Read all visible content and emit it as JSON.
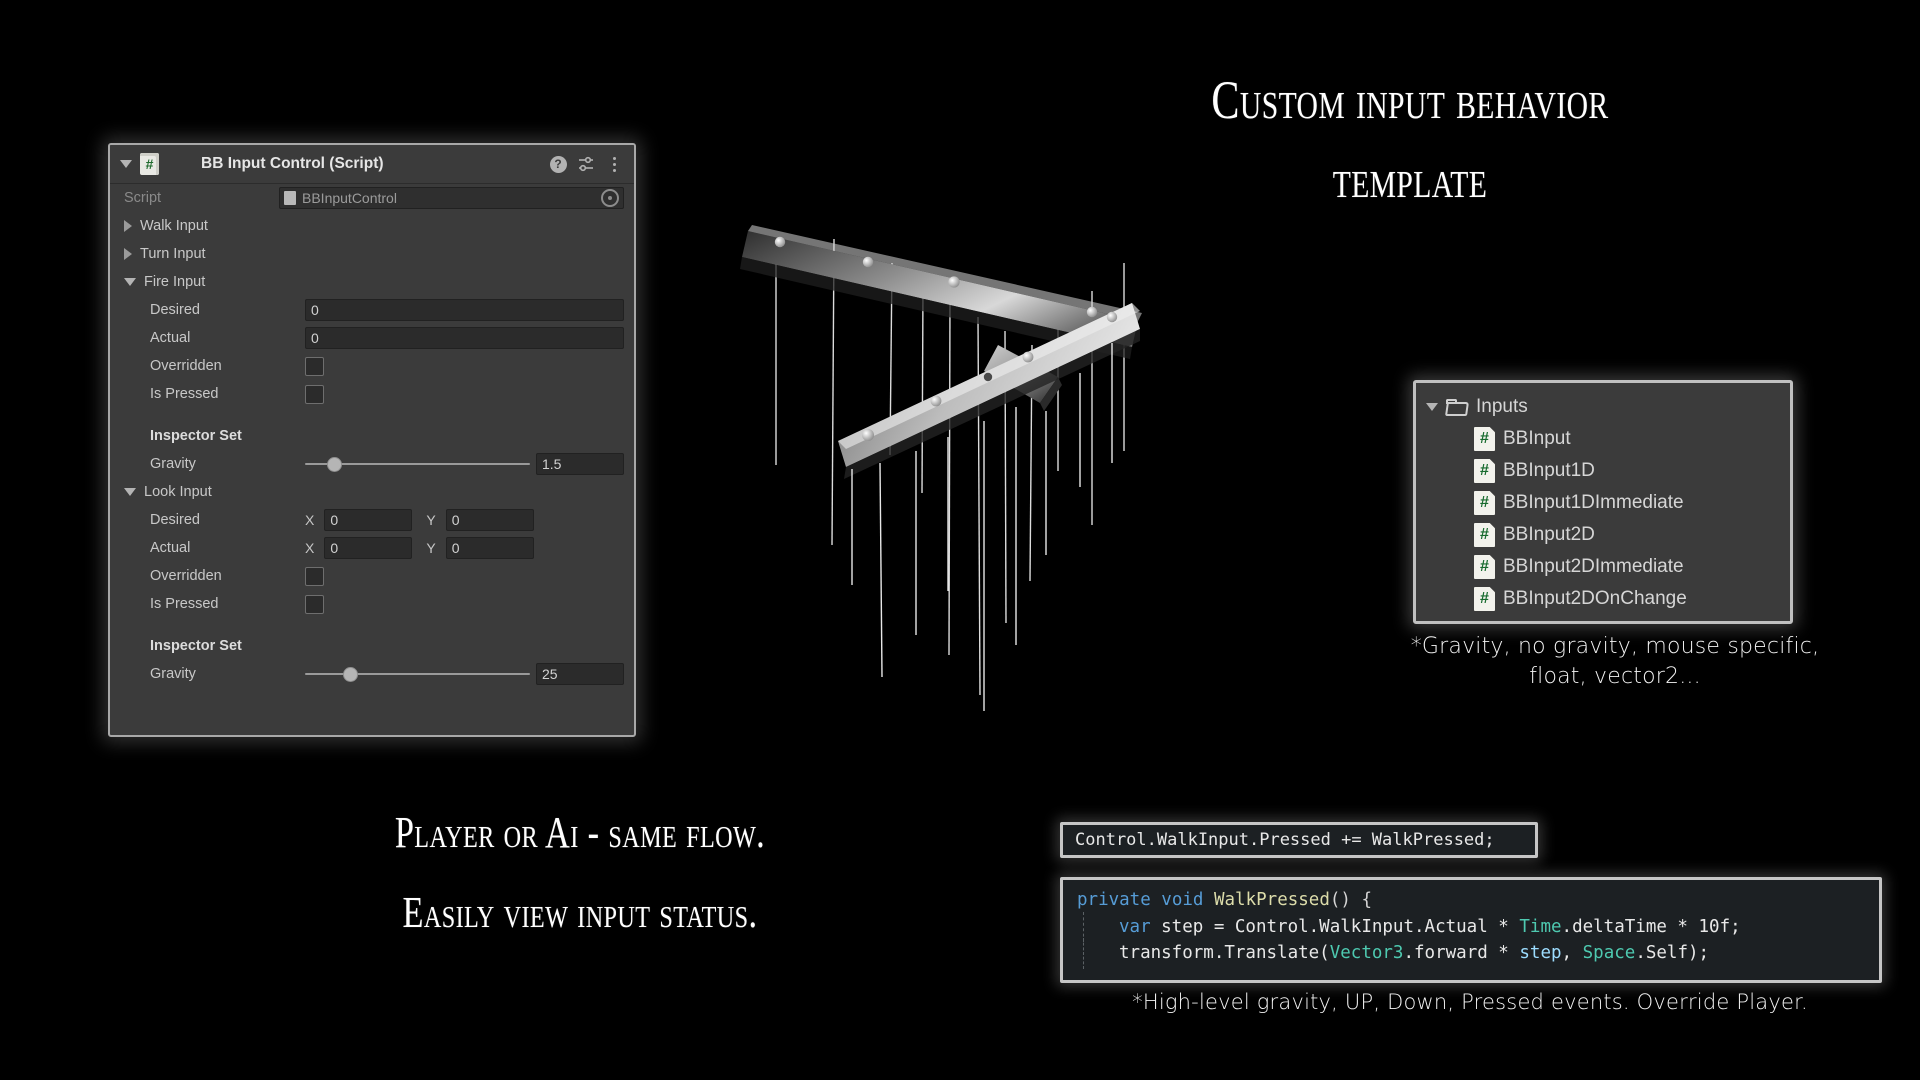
{
  "headline": {
    "line1": "Custom input behavior",
    "line2": "template"
  },
  "tagline": {
    "line1": "Player or Ai - same flow.",
    "line2": "Easily view input status."
  },
  "inspector": {
    "component_title": "BB Input Control (Script)",
    "foldout_open": "▼",
    "script_icon_glyph": "#",
    "header_icons": {
      "help": "?",
      "preset": "preset-icon",
      "menu": "kebab-menu-icon"
    },
    "script_row": {
      "label": "Script",
      "value": "BBInputControl"
    },
    "sections": [
      {
        "label": "Walk Input",
        "expanded": false
      },
      {
        "label": "Turn Input",
        "expanded": false
      }
    ],
    "fire_input": {
      "label": "Fire Input",
      "desired_label": "Desired",
      "desired_value": "0",
      "actual_label": "Actual",
      "actual_value": "0",
      "overridden_label": "Overridden",
      "overridden_checked": false,
      "is_pressed_label": "Is Pressed",
      "is_pressed_checked": false,
      "inspector_set_label": "Inspector Set",
      "gravity_label": "Gravity",
      "gravity_value": "1.5",
      "gravity_knob_percent": 13
    },
    "look_input": {
      "label": "Look Input",
      "desired_label": "Desired",
      "desired_x_axis": "X",
      "desired_x": "0",
      "desired_y_axis": "Y",
      "desired_y": "0",
      "actual_label": "Actual",
      "actual_x_axis": "X",
      "actual_x": "0",
      "actual_y_axis": "Y",
      "actual_y": "0",
      "overridden_label": "Overridden",
      "overridden_checked": false,
      "is_pressed_label": "Is Pressed",
      "is_pressed_checked": false,
      "inspector_set_label": "Inspector Set",
      "gravity_label": "Gravity",
      "gravity_value": "25",
      "gravity_knob_percent": 20
    }
  },
  "project_panel": {
    "root": {
      "label": "Inputs",
      "icon": "folder-icon",
      "expanded": true
    },
    "items": [
      {
        "label": "BBInput",
        "icon": "csharp-script-icon"
      },
      {
        "label": "BBInput1D",
        "icon": "csharp-script-icon"
      },
      {
        "label": "BBInput1DImmediate",
        "icon": "csharp-script-icon"
      },
      {
        "label": "BBInput2D",
        "icon": "csharp-script-icon"
      },
      {
        "label": "BBInput2DImmediate",
        "icon": "csharp-script-icon"
      },
      {
        "label": "BBInput2DOnChange",
        "icon": "csharp-script-icon"
      }
    ],
    "caption": "*Gravity, no gravity, mouse specific, float, vector2..."
  },
  "code": {
    "one_liner": "Control.WalkInput.Pressed += WalkPressed;",
    "block": {
      "line1_kw": "private void",
      "line1_fn": " WalkPressed",
      "line1_tail": "() {",
      "line2_kw": "var",
      "line2_a": " step = Control.WalkInput.Actual * ",
      "line2_type": "Time",
      "line2_b": ".deltaTime * 10f;",
      "line3_a": "transform.Translate(",
      "line3_type": "Vector3",
      "line3_b": ".forward * ",
      "line3_var": "step",
      "line3_c": ", ",
      "line3_type2": "Space",
      "line3_d": ".Self);"
    },
    "caption": "*High-level gravity, UP, Down, Pressed events. Override Player."
  },
  "colors": {
    "background": "#000000",
    "panel": "#3b3b3b",
    "panel_border": "#a8a8a8",
    "field": "#2b2b2b",
    "text": "#c8c8c8",
    "code_background": "#1c2023",
    "keyword": "#569cd6",
    "type": "#4ec9b0",
    "function": "#dcdcaa",
    "script_green": "#176b2e"
  }
}
